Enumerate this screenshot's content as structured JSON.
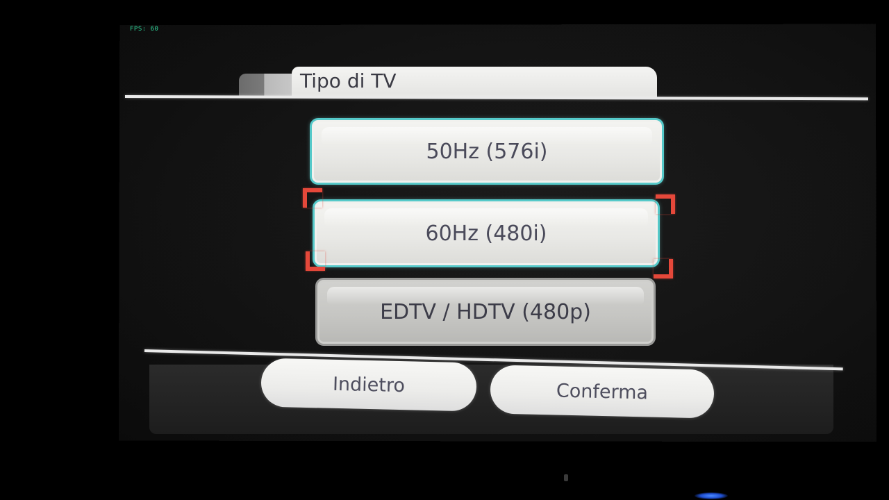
{
  "overlay": {
    "fps_label": "FPS: 60"
  },
  "header": {
    "title": "Tipo di TV"
  },
  "options": [
    {
      "label": "50Hz (576i)",
      "state": "available"
    },
    {
      "label": "60Hz (480i)",
      "state": "available",
      "highlighted": true
    },
    {
      "label": "EDTV / HDTV (480p)",
      "state": "disabled"
    }
  ],
  "footer": {
    "back_label": "Indietro",
    "confirm_label": "Conferma"
  },
  "colors": {
    "selection_corner": "#e5483a",
    "button_outline": "#55c9c9",
    "screen_background": "#161616",
    "button_fill": "#eeeeec"
  }
}
